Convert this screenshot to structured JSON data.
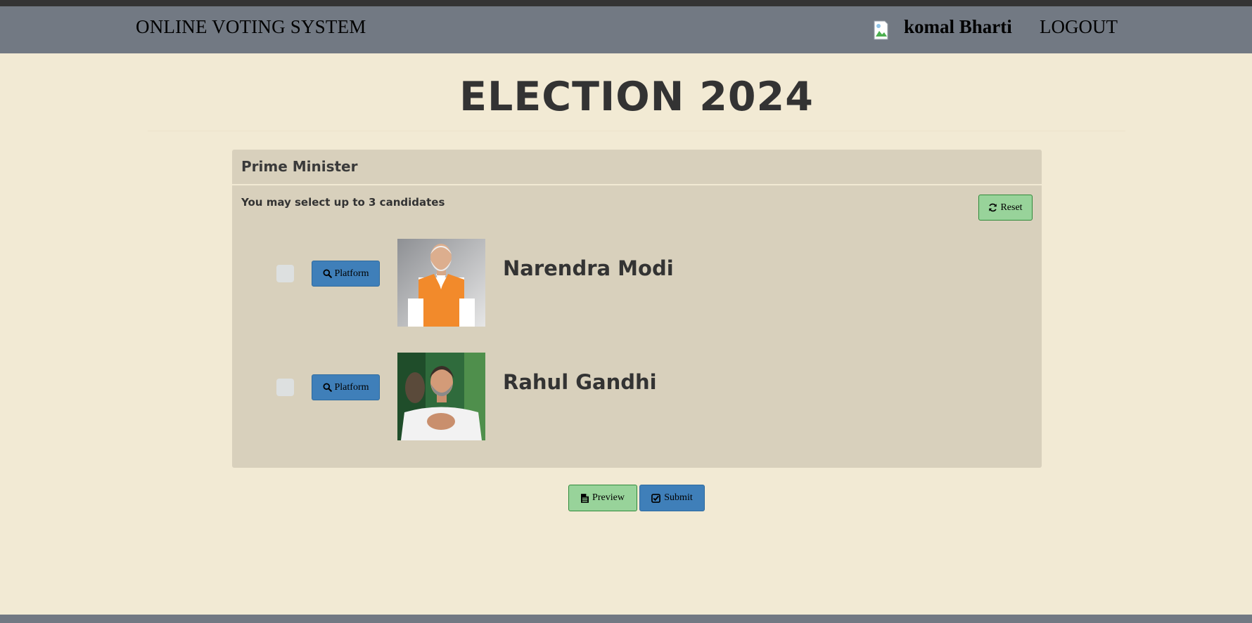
{
  "navbar": {
    "brand": "ONLINE VOTING SYSTEM",
    "user_name": "komal Bharti",
    "logout_label": "LOGOUT",
    "avatar_icon": "broken-image-icon"
  },
  "page": {
    "title": "ELECTION 2024"
  },
  "position": {
    "title": "Prime Minister",
    "instruction": "You may select up to 3 candidates",
    "reset_label": "Reset",
    "reset_icon": "refresh-icon",
    "candidates": [
      {
        "name": "Narendra Modi",
        "platform_label": "Platform",
        "platform_icon": "search-icon",
        "checked": false,
        "photo": "candidate-photo"
      },
      {
        "name": "Rahul Gandhi",
        "platform_label": "Platform",
        "platform_icon": "search-icon",
        "checked": false,
        "photo": "candidate-photo"
      }
    ]
  },
  "actions": {
    "preview_label": "Preview",
    "preview_icon": "file-text-icon",
    "submit_label": "Submit",
    "submit_icon": "check-square-icon"
  },
  "colors": {
    "page_bg": "#f2ead4",
    "navbar_bg": "#727983",
    "panel_bg": "#d8d0bc",
    "success": "#98d39a",
    "primary": "#3f7fb9"
  }
}
